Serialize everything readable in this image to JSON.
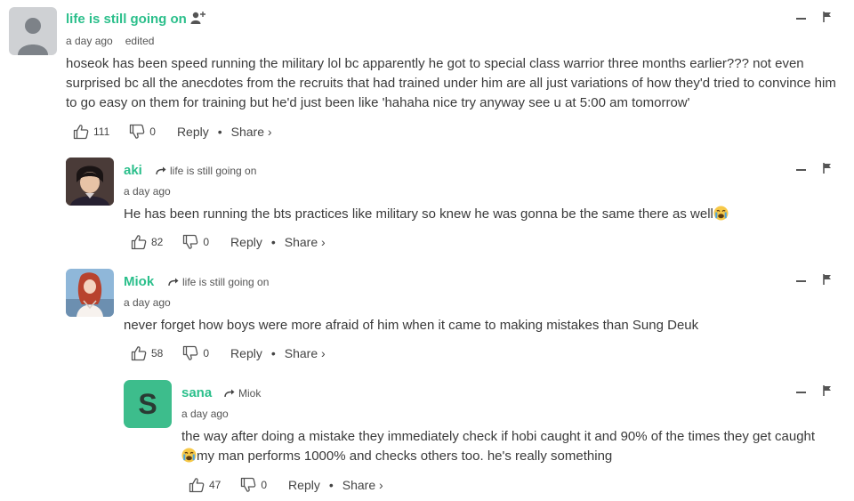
{
  "comments": [
    {
      "author": "life is still going on",
      "time": "a day ago",
      "edited": "edited",
      "text": "hoseok has been speed running the military lol bc apparently he got to special class warrior three months earlier??? not even surprised bc all the anecdotes from the recruits that had trained under him are all just variations of how they'd tried to convince him to go easy on them for training but he'd just been like 'hahaha nice try anyway see u at 5:00 am tomorrow'",
      "likes": "111",
      "dislikes": "0",
      "reply_label": "Reply",
      "share_label": "Share ›"
    },
    {
      "author": "aki",
      "reply_to": "life is still going on",
      "time": "a day ago",
      "text": "He has been running the bts practices like military so knew he was gonna be the same there as well",
      "likes": "82",
      "dislikes": "0",
      "reply_label": "Reply",
      "share_label": "Share ›"
    },
    {
      "author": "Miok",
      "reply_to": "life is still going on",
      "time": "a day ago",
      "text": "never forget how boys were more afraid of him when it came to making mistakes than Sung Deuk",
      "likes": "58",
      "dislikes": "0",
      "reply_label": "Reply",
      "share_label": "Share ›"
    },
    {
      "author": "sana",
      "avatar_letter": "S",
      "reply_to": "Miok",
      "time": "a day ago",
      "text_line1": "the way after doing a mistake they immediately check if hobi caught it and 90% of the times they get caught",
      "text_line2": "my man performs 1000% and checks others too. he's really something",
      "likes": "47",
      "dislikes": "0",
      "reply_label": "Reply",
      "share_label": "Share ›"
    }
  ],
  "colors": {
    "accent": "#2bbf8b",
    "text": "#3a3a3a",
    "sana_avatar": "#3dbd8c"
  },
  "icons": [
    "follow-user-icon",
    "collapse-icon",
    "flag-icon",
    "thumbs-up-icon",
    "thumbs-down-icon",
    "reply-arrow-icon",
    "crying-emoji-icon"
  ]
}
